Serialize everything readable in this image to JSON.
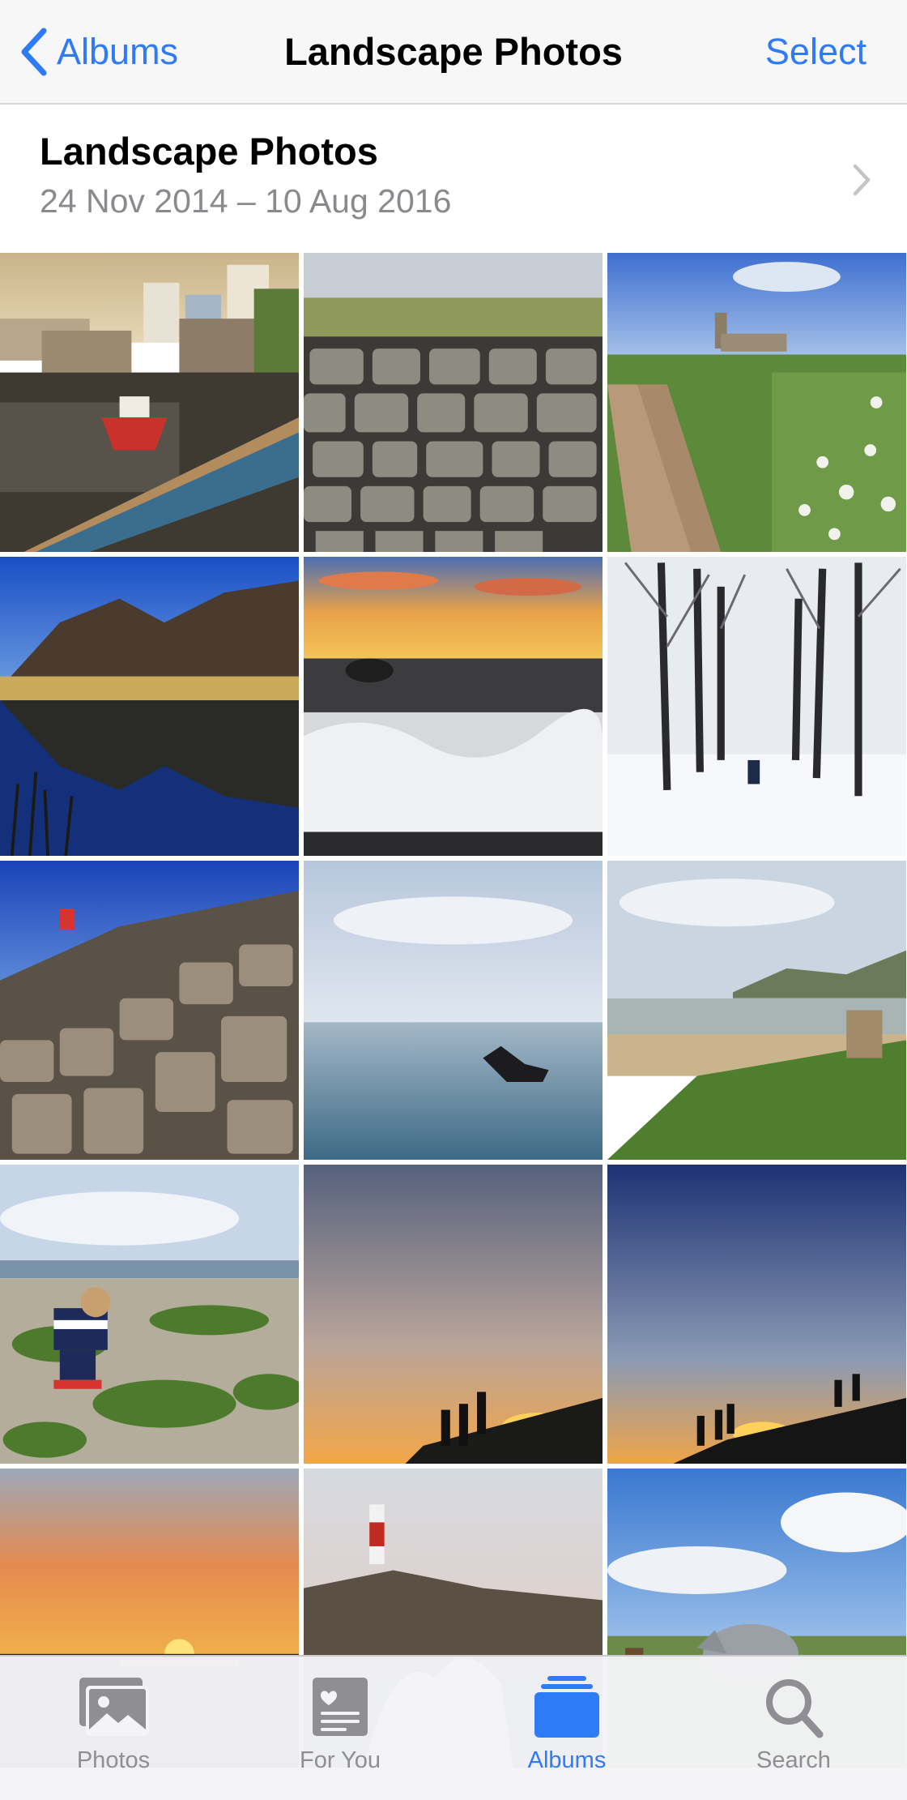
{
  "navbar": {
    "back_label": "Albums",
    "title": "Landscape Photos",
    "select_label": "Select"
  },
  "album": {
    "title": "Landscape Photos",
    "date_range": "24 Nov 2014 – 10 Aug 2016"
  },
  "photos": [
    {
      "name": "harbour-boats"
    },
    {
      "name": "stone-wall-grass"
    },
    {
      "name": "country-path-church"
    },
    {
      "name": "mountain-lake-reflection"
    },
    {
      "name": "sunset-waves"
    },
    {
      "name": "snowy-tree-avenue"
    },
    {
      "name": "rock-columns-climber"
    },
    {
      "name": "dog-in-sea"
    },
    {
      "name": "coastal-beach-grass"
    },
    {
      "name": "child-on-seaweed-beach"
    },
    {
      "name": "silhouettes-sunset"
    },
    {
      "name": "silhouettes-dusk"
    },
    {
      "name": "ocean-sunset"
    },
    {
      "name": "lighthouse-waves"
    },
    {
      "name": "grazing-horse"
    }
  ],
  "tabbar": {
    "tabs": [
      {
        "label": "Photos",
        "icon": "photos-icon",
        "active": false
      },
      {
        "label": "For You",
        "icon": "for-you-icon",
        "active": false
      },
      {
        "label": "Albums",
        "icon": "albums-icon",
        "active": true
      },
      {
        "label": "Search",
        "icon": "search-icon",
        "active": false
      }
    ]
  },
  "colors": {
    "accent": "#2f7bf5",
    "inactive_tab": "#8e8e93",
    "secondary_text": "#8a8a8e"
  }
}
